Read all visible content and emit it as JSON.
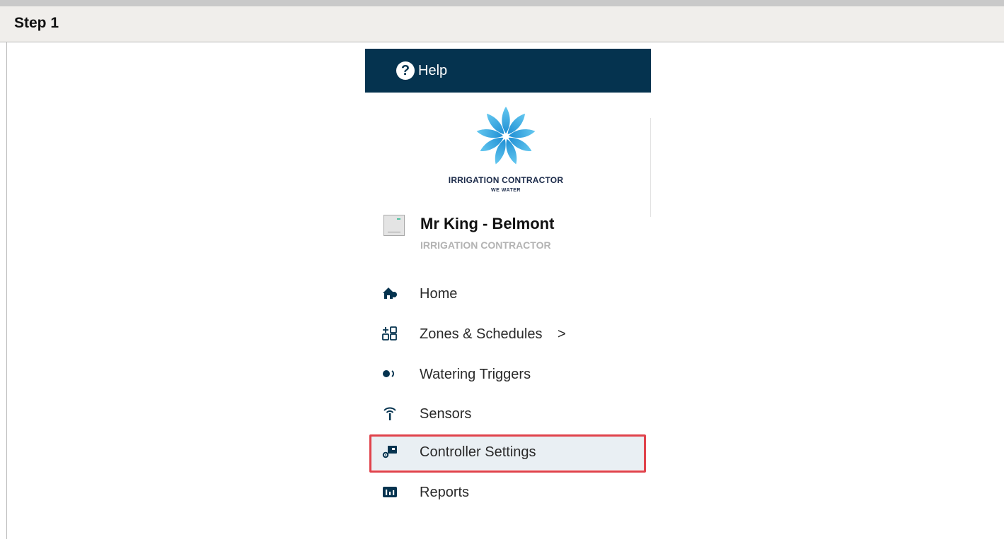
{
  "step": {
    "title": "Step 1"
  },
  "help": {
    "label": "Help",
    "icon": "question-circle-icon"
  },
  "brand": {
    "name": "IRRIGATION CONTRACTOR",
    "tagline": "WE WATER",
    "logo_color": "#3aa8e0"
  },
  "site": {
    "name": "Mr King - Belmont",
    "owner": "IRRIGATION CONTRACTOR"
  },
  "nav": {
    "items": [
      {
        "label": "Home",
        "icon": "home-icon"
      },
      {
        "label": "Zones & Schedules",
        "icon": "zones-grid-icon",
        "chevron": ">"
      },
      {
        "label": "Watering Triggers",
        "icon": "trigger-icon"
      },
      {
        "label": "Sensors",
        "icon": "antenna-icon"
      },
      {
        "label": "Controller Settings",
        "icon": "controller-settings-icon",
        "selected": true
      },
      {
        "label": "Reports",
        "icon": "reports-icon"
      }
    ]
  },
  "colors": {
    "header": "#05334f",
    "highlight": "#e0424b",
    "selected_bg": "#e9eff3"
  }
}
